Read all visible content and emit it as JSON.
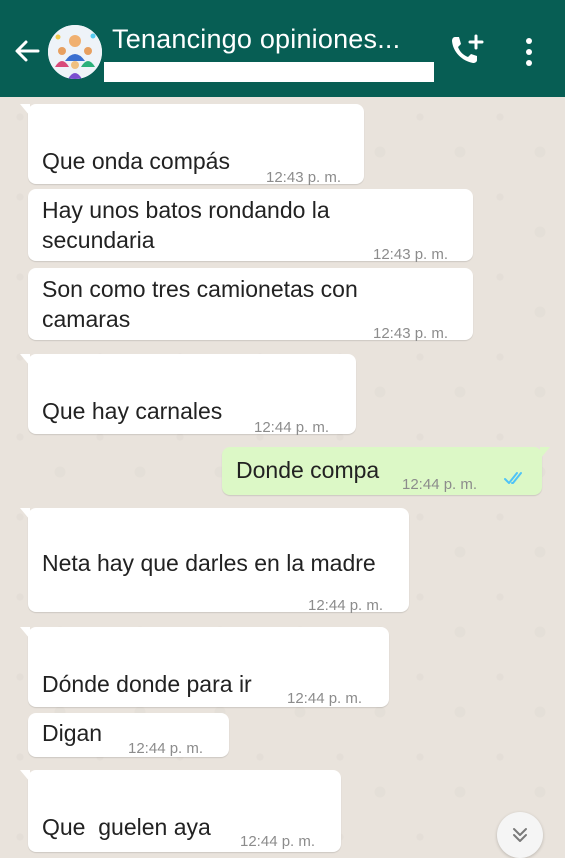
{
  "header": {
    "title": "Tenancingo opiniones...",
    "subtitle": ""
  },
  "colors": {
    "header": "#075e54",
    "incoming_bubble": "#ffffff",
    "outgoing_bubble": "#dcf8c6",
    "read_ticks": "#4fc3f7",
    "chat_background": "#e9e3dc"
  },
  "icons": {
    "back": "arrow-left-icon",
    "avatar": "group-avatar",
    "call": "add-call-icon",
    "menu": "more-vertical-icon",
    "scroll": "chevron-double-down-icon"
  },
  "messages": [
    {
      "text": "Que onda compás",
      "time": "12:43 p. m.",
      "direction": "in"
    },
    {
      "text_lines": [
        "Hay unos batos rondando la",
        "secundaria"
      ],
      "time": "12:43 p. m.",
      "direction": "in"
    },
    {
      "text_lines": [
        "Son como tres camionetas con",
        "camaras"
      ],
      "time": "12:43 p. m.",
      "direction": "in"
    },
    {
      "text": "Que hay carnales",
      "time": "12:44 p. m.",
      "direction": "in"
    },
    {
      "text": "Donde compa",
      "time": "12:44 p. m.",
      "direction": "out",
      "status": "read"
    },
    {
      "text": "Neta hay que darles en la madre",
      "time": "12:44 p. m.",
      "direction": "in"
    },
    {
      "text": "Dónde donde para ir",
      "time": "12:44 p. m.",
      "direction": "in"
    },
    {
      "text": "Digan",
      "time": "12:44 p. m.",
      "direction": "in"
    },
    {
      "text": "Que  guelen aya",
      "time": "12:44 p. m.",
      "direction": "in"
    }
  ]
}
